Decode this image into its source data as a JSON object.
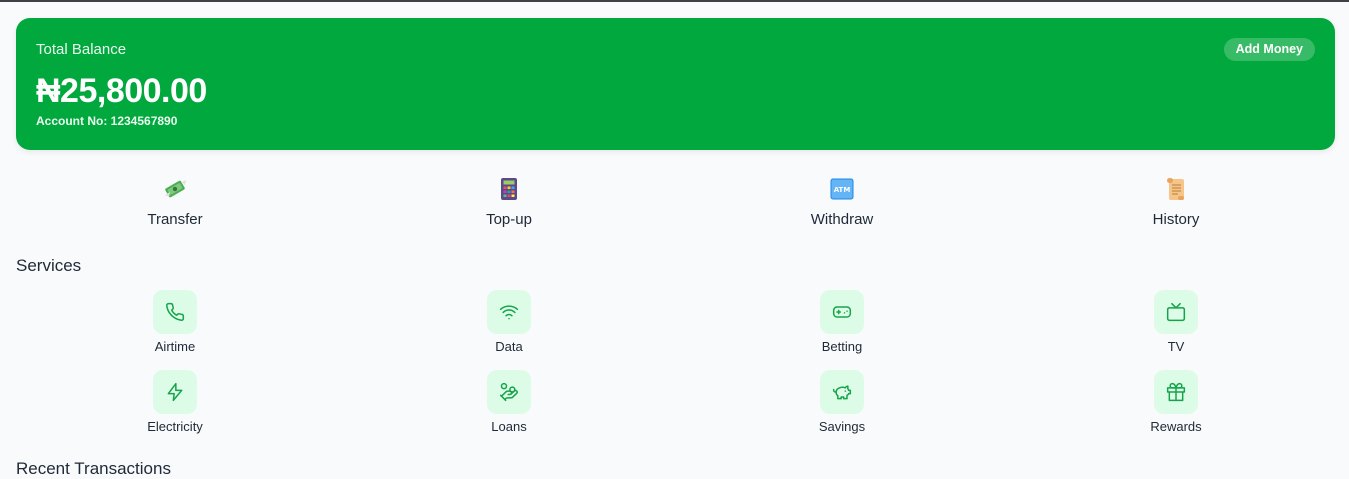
{
  "balance": {
    "label": "Total Balance",
    "amount": "₦25,800.00",
    "account": "Account No: 1234567890",
    "add_money": "Add Money"
  },
  "quick_actions": [
    {
      "label": "Transfer",
      "icon": "money-wings-icon"
    },
    {
      "label": "Top-up",
      "icon": "calculator-icon"
    },
    {
      "label": "Withdraw",
      "icon": "atm-icon"
    },
    {
      "label": "History",
      "icon": "scroll-icon"
    }
  ],
  "services_title": "Services",
  "services": [
    {
      "label": "Airtime",
      "icon": "phone-icon"
    },
    {
      "label": "Data",
      "icon": "wifi-icon"
    },
    {
      "label": "Betting",
      "icon": "gamepad-icon"
    },
    {
      "label": "TV",
      "icon": "tv-icon"
    },
    {
      "label": "Electricity",
      "icon": "lightning-icon"
    },
    {
      "label": "Loans",
      "icon": "hand-coins-icon"
    },
    {
      "label": "Savings",
      "icon": "piggy-bank-icon"
    },
    {
      "label": "Rewards",
      "icon": "gift-icon"
    }
  ],
  "recent_title": "Recent Transactions",
  "colors": {
    "brand": "#00a83d",
    "service_bg": "#dcfce7",
    "service_icon": "#16a34a"
  }
}
